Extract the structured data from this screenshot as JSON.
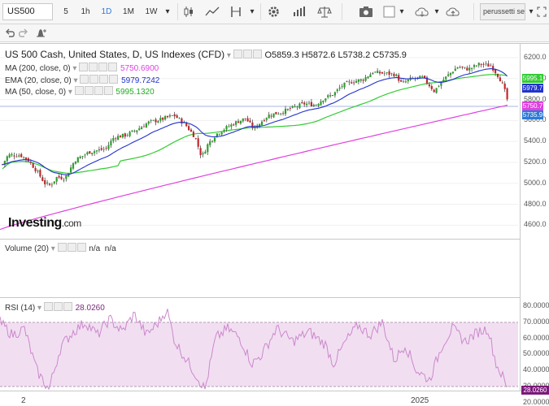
{
  "toolbar": {
    "symbol": "US500",
    "intervals": [
      "5",
      "1h",
      "1D",
      "1M",
      "1W"
    ],
    "active_interval": "1D",
    "user": "perussetti sepe"
  },
  "legend": {
    "title": "US 500 Cash, United States, D, US Indexes (CFD)",
    "ohlc": [
      {
        "k": "O",
        "v": "5859.3"
      },
      {
        "k": "H",
        "v": "5872.6"
      },
      {
        "k": "L",
        "v": "5738.2"
      },
      {
        "k": "C",
        "v": "5735.9"
      }
    ],
    "indicators": [
      {
        "name": "MA (200, close, 0)",
        "value": "5750.6900",
        "color": "#e040e0"
      },
      {
        "name": "EMA (20, close, 0)",
        "value": "5979.7242",
        "color": "#2233cc"
      },
      {
        "name": "MA (50, close, 0)",
        "value": "5995.1320",
        "color": "#33cc33"
      }
    ]
  },
  "price_axis": {
    "ticks": [
      "6200.0",
      "6000.0",
      "5800.0",
      "5600.0",
      "5400.0",
      "5200.0",
      "5000.0",
      "4800.0",
      "4600.0"
    ],
    "tags": [
      {
        "label": "5995.1",
        "color": "#33cc33"
      },
      {
        "label": "5979.7",
        "color": "#2233cc"
      },
      {
        "label": "5750.7",
        "color": "#e040e0"
      },
      {
        "label": "5735.9",
        "color": "#2b7bd8"
      }
    ]
  },
  "watermark": {
    "brand": "Investing",
    "suffix": ".com"
  },
  "volume": {
    "name": "Volume (20)",
    "values": [
      "n/a",
      "n/a"
    ]
  },
  "rsi": {
    "name": "RSI (14)",
    "value": "28.0260",
    "ticks": [
      "80.0000",
      "70.0000",
      "60.0000",
      "50.0000",
      "40.0000",
      "30.0000",
      "20.0000"
    ],
    "tag": "28.0260",
    "upper": 70,
    "lower": 30
  },
  "x_axis": {
    "labels": [
      "2",
      "2025"
    ]
  },
  "chart_data": {
    "type": "candlestick",
    "series": [
      {
        "name": "US 500 Cash",
        "role": "price",
        "close_last": 5735.9
      },
      {
        "name": "MA (200, close, 0)",
        "last": 5750.69
      },
      {
        "name": "EMA (20, close, 0)",
        "last": 5979.72
      },
      {
        "name": "MA (50, close, 0)",
        "last": 5995.13
      },
      {
        "name": "RSI (14)",
        "last": 28.026
      }
    ],
    "ylim": [
      4550,
      6250
    ],
    "rsi_ylim": [
      20,
      80
    ]
  }
}
